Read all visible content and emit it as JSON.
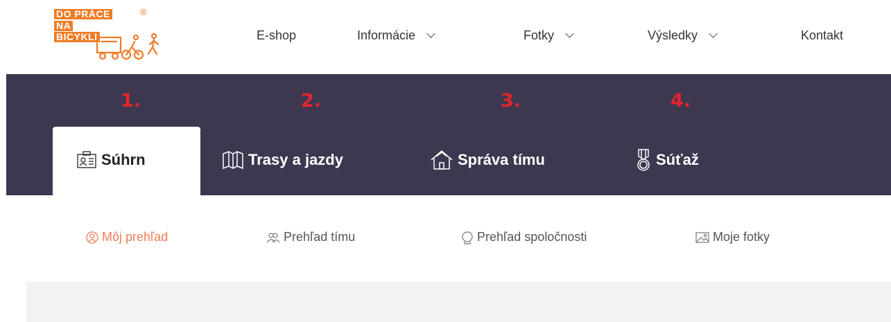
{
  "logo": {
    "line1": "DO PRÁCE",
    "line2": "NA",
    "line3": "BICYKLI",
    "registered": "®",
    "icon": "bicycle-pedestrian-logo-icon"
  },
  "topnav": [
    {
      "label": "E-shop",
      "dropdown": false
    },
    {
      "label": "Informácie",
      "dropdown": true
    },
    {
      "label": "Fotky",
      "dropdown": true
    },
    {
      "label": "Výsledky",
      "dropdown": true
    },
    {
      "label": "Kontakt",
      "dropdown": false
    }
  ],
  "annotations": [
    "1.",
    "2.",
    "3.",
    "4."
  ],
  "tabs": [
    {
      "label": "Súhrn",
      "icon": "id-card-icon",
      "active": true
    },
    {
      "label": "Trasy a jazdy",
      "icon": "map-icon",
      "active": false
    },
    {
      "label": "Správa tímu",
      "icon": "house-icon",
      "active": false
    },
    {
      "label": "Súťaž",
      "icon": "medal-icon",
      "active": false
    }
  ],
  "subnav": [
    {
      "label": "Môj prehľad",
      "icon": "person-icon",
      "active": true
    },
    {
      "label": "Prehľad tímu",
      "icon": "team-icon",
      "active": false
    },
    {
      "label": "Prehľad spoločnosti",
      "icon": "company-icon",
      "active": false
    },
    {
      "label": "Moje fotky",
      "icon": "image-icon",
      "active": false
    }
  ],
  "colors": {
    "brand_orange": "#f07c27",
    "band_purple": "#3e3750",
    "annotation_red": "#e3262e",
    "active_subnav": "#f07c54",
    "gray_area": "#f3f3f4"
  }
}
